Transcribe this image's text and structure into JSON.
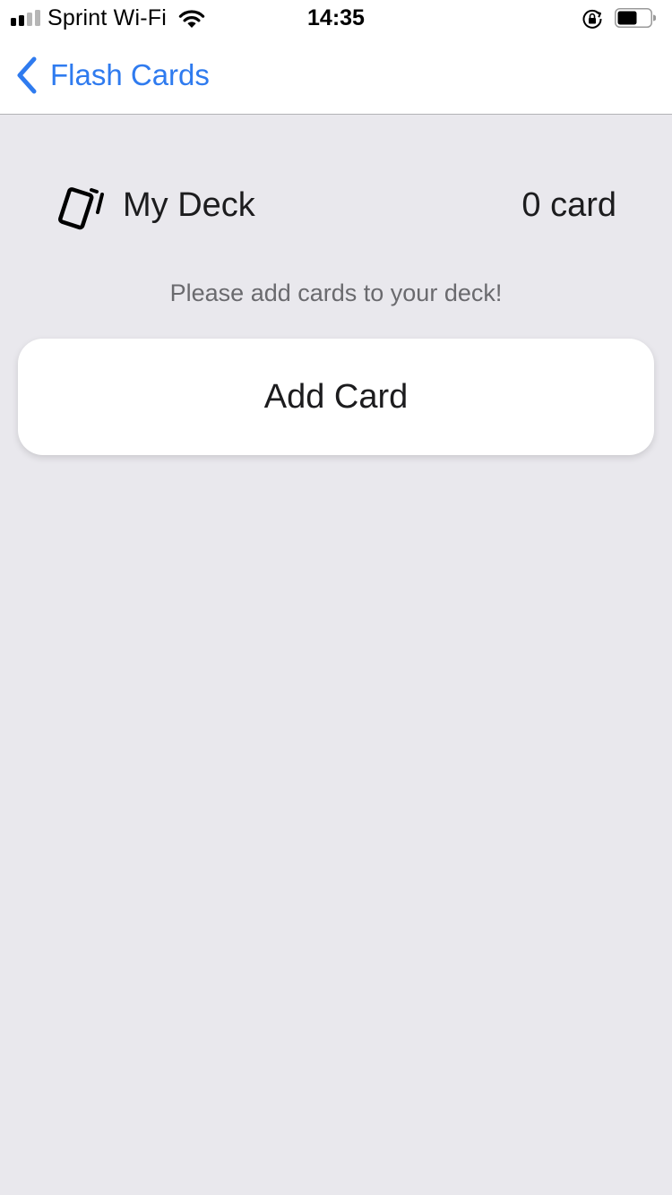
{
  "status_bar": {
    "carrier": "Sprint Wi-Fi",
    "time": "14:35",
    "signal_bars_active": 2,
    "signal_bars_total": 4,
    "icons": [
      "signal-icon",
      "wifi-icon",
      "rotation-lock-icon",
      "battery-icon"
    ],
    "battery_level": 0.6
  },
  "nav": {
    "back_label": "Flash Cards",
    "back_icon": "chevron-left-icon"
  },
  "deck": {
    "icon": "cards-icon",
    "title": "My Deck",
    "count_text": "0 card"
  },
  "empty_message": "Please add cards to your deck!",
  "add_button": {
    "label": "Add Card"
  },
  "colors": {
    "accent": "#2f7bef",
    "background": "#e9e8ed",
    "surface": "#ffffff",
    "text": "#1c1c1e",
    "muted": "#6a6a6e"
  }
}
